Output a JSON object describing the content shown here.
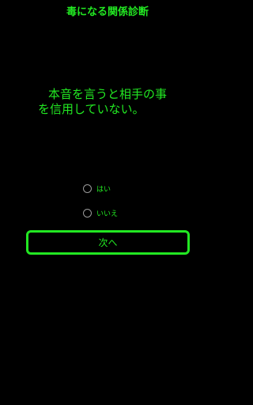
{
  "app": {
    "title": "毒になる関係診断",
    "accent_color": "#22e722",
    "background_color": "#000000"
  },
  "question": {
    "line1": "本音を言うと相手の事",
    "line2": "を信用していない。"
  },
  "options": [
    {
      "label": "はい",
      "selected": false
    },
    {
      "label": "いいえ",
      "selected": false
    }
  ],
  "next_button": {
    "label": "次へ"
  }
}
